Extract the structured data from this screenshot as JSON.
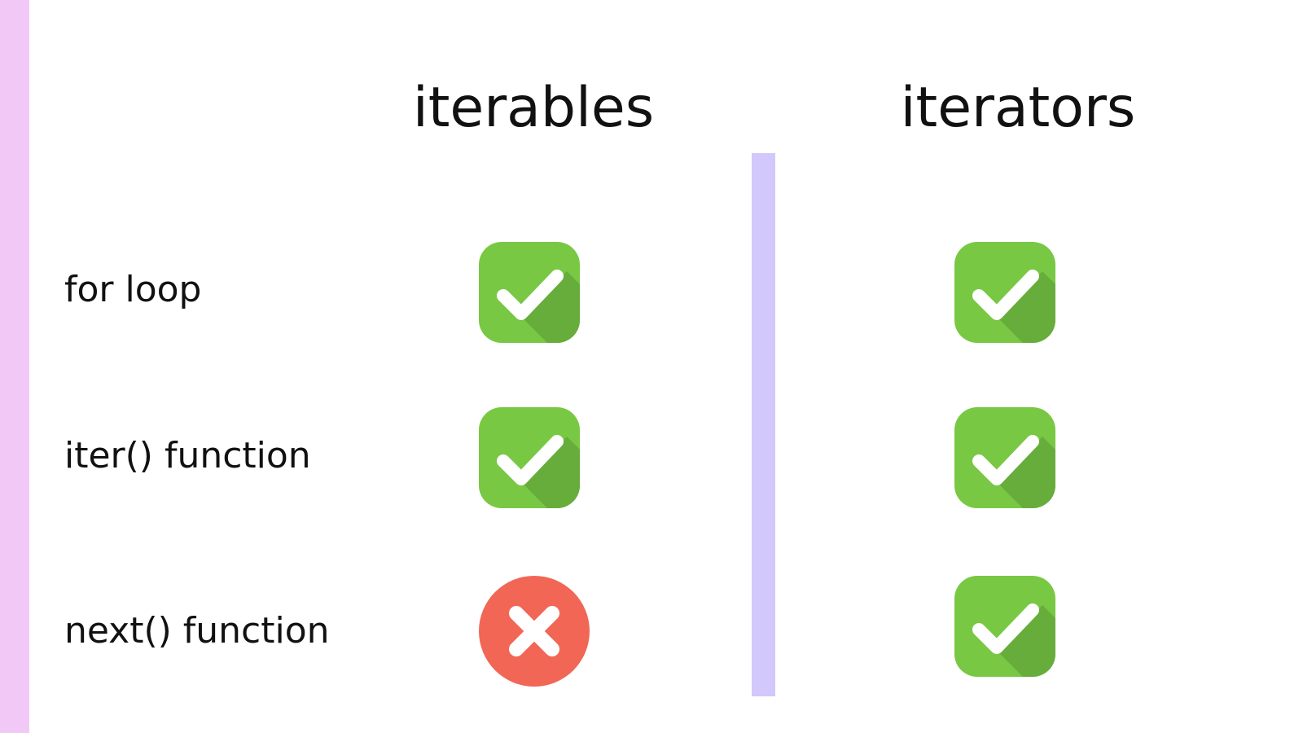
{
  "columns": [
    {
      "id": "iterables",
      "title": "iterables"
    },
    {
      "id": "iterators",
      "title": "iterators"
    }
  ],
  "rows": [
    {
      "label": "for loop",
      "iterables": "check",
      "iterators": "check"
    },
    {
      "label": "iter() function",
      "iterables": "check",
      "iterators": "check"
    },
    {
      "label": "next() function",
      "iterables": "cross",
      "iterators": "check"
    }
  ],
  "colors": {
    "left_stripe": "#f2c9f6",
    "divider": "#d2c8fc",
    "check_green": "#78c843",
    "check_shadow": "#67ad3b",
    "cross_red": "#f26656"
  },
  "icons": {
    "check": "check-badge-icon",
    "cross": "cross-circle-icon"
  }
}
